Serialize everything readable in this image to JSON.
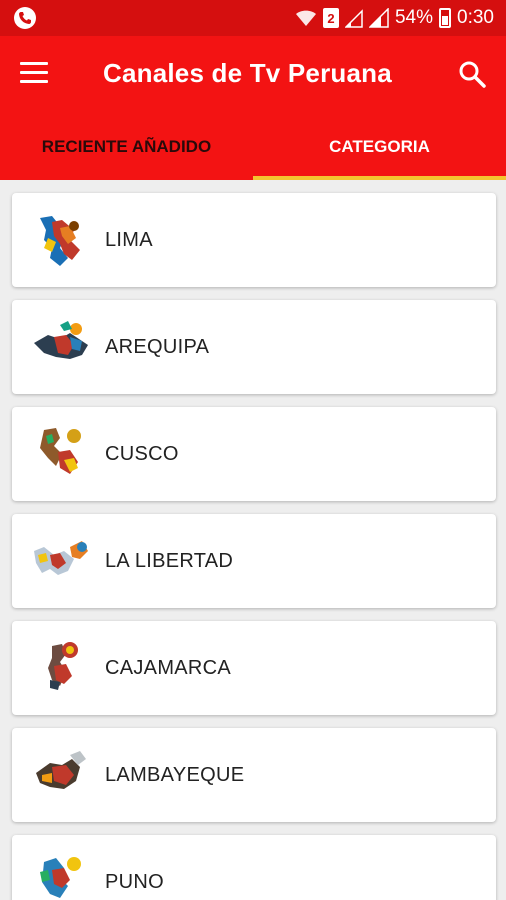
{
  "status_bar": {
    "sim_slot": "2",
    "battery_percent": "54%",
    "time": "0:30"
  },
  "app_bar": {
    "title": "Canales de Tv Peruana",
    "menu_icon": "hamburger-menu-icon",
    "search_icon": "search-icon"
  },
  "tabs": [
    {
      "label": "RECIENTE AÑADIDO",
      "active": false
    },
    {
      "label": "CATEGORIA",
      "active": true
    }
  ],
  "colors": {
    "status_bar": "#d50f0f",
    "app_bar": "#f31313",
    "tab_indicator": "#f4c430",
    "background": "#eeeeee"
  },
  "categories": [
    {
      "label": "LIMA",
      "icon": "lima-map-thumbnail"
    },
    {
      "label": "AREQUIPA",
      "icon": "arequipa-map-thumbnail"
    },
    {
      "label": "CUSCO",
      "icon": "cusco-map-thumbnail"
    },
    {
      "label": "LA LIBERTAD",
      "icon": "la-libertad-map-thumbnail"
    },
    {
      "label": "CAJAMARCA",
      "icon": "cajamarca-map-thumbnail"
    },
    {
      "label": "LAMBAYEQUE",
      "icon": "lambayeque-map-thumbnail"
    },
    {
      "label": "PUNO",
      "icon": "puno-map-thumbnail"
    }
  ]
}
